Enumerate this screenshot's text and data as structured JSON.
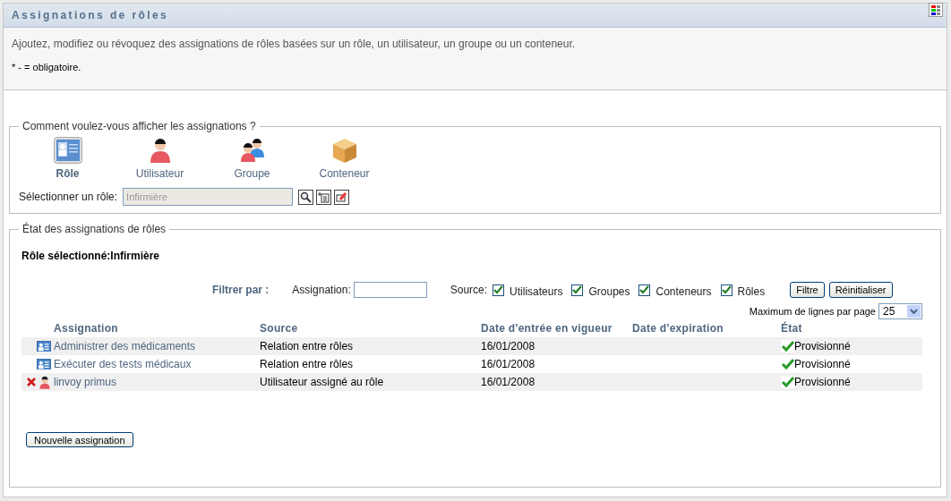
{
  "panel": {
    "title": "Assignations de rôles",
    "description": "Ajoutez, modifiez ou révoquez des assignations de rôles basées sur un rôle, un utilisateur, un groupe ou un conteneur.",
    "required_note": "* - = obligatoire."
  },
  "view_section": {
    "legend": "Comment voulez-vous afficher les assignations ?",
    "options": [
      {
        "label": "Rôle",
        "kind": "role",
        "selected": true
      },
      {
        "label": "Utilisateur",
        "kind": "user",
        "selected": false
      },
      {
        "label": "Groupe",
        "kind": "group",
        "selected": false
      },
      {
        "label": "Conteneur",
        "kind": "container",
        "selected": false
      }
    ],
    "select_label": "Sélectionner un rôle:",
    "select_value": "Infirmière"
  },
  "status_section": {
    "legend": "État des assignations de rôles",
    "selected_label": "Rôle sélectionné:",
    "selected_value": "Infirmière",
    "filter": {
      "title": "Filtrer par :",
      "assignment_label": "Assignation:",
      "source_label": "Source:",
      "sources": [
        {
          "label": "Utilisateurs",
          "checked": true
        },
        {
          "label": "Groupes",
          "checked": true
        },
        {
          "label": "Conteneurs",
          "checked": true
        },
        {
          "label": "Rôles",
          "checked": true
        }
      ],
      "buttons": [
        "Filtre",
        "Réinitialiser"
      ]
    },
    "page_size_label": "Maximum de lignes par page",
    "page_size": "25",
    "columns": [
      "Assignation",
      "Source",
      "Date d'entrée en vigueur",
      "Date d'expiration",
      "État"
    ],
    "rows": [
      {
        "kind": "role",
        "removable": false,
        "assignment": "Administrer des médicaments",
        "source": "Relation entre rôles",
        "start": "16/01/2008",
        "status": "Provisionné"
      },
      {
        "kind": "role",
        "removable": false,
        "assignment": "Exécuter des tests médicaux",
        "source": "Relation entre rôles",
        "start": "16/01/2008",
        "status": "Provisionné"
      },
      {
        "kind": "user",
        "removable": true,
        "assignment": "linvoy primus",
        "source": "Utilisateur assigné au rôle",
        "start": "16/01/2008",
        "status": "Provisionné"
      }
    ],
    "new_button": "Nouvelle assignation"
  }
}
